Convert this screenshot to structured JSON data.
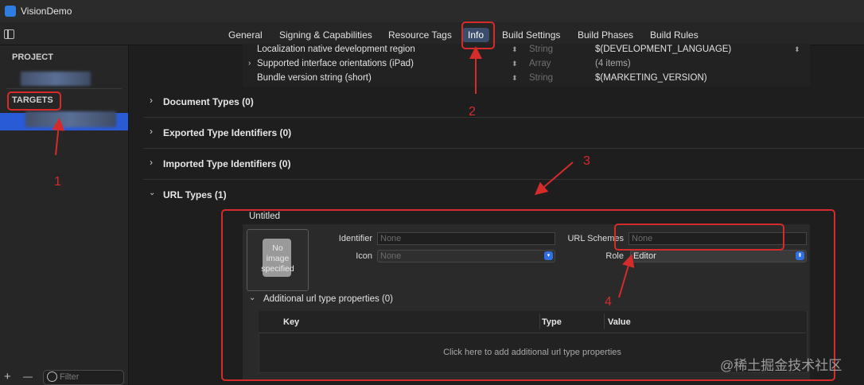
{
  "app": {
    "title": "VisionDemo"
  },
  "tabs": [
    {
      "label": "General"
    },
    {
      "label": "Signing & Capabilities"
    },
    {
      "label": "Resource Tags"
    },
    {
      "label": "Info"
    },
    {
      "label": "Build Settings"
    },
    {
      "label": "Build Phases"
    },
    {
      "label": "Build Rules"
    }
  ],
  "sidebar": {
    "project_header": "PROJECT",
    "targets_header": "TARGETS",
    "add": "+",
    "remove": "—",
    "filter_placeholder": "Filter"
  },
  "properties": [
    {
      "key": "Localization native development region",
      "type": "String",
      "value": "$(DEVELOPMENT_LANGUAGE)"
    },
    {
      "key": "Supported interface orientations (iPad)",
      "type": "Array",
      "value": "(4 items)"
    },
    {
      "key": "Bundle version string (short)",
      "type": "String",
      "value": "$(MARKETING_VERSION)"
    }
  ],
  "sections": [
    {
      "title": "Document Types (0)"
    },
    {
      "title": "Exported Type Identifiers (0)"
    },
    {
      "title": "Imported Type Identifiers (0)"
    },
    {
      "title": "URL Types (1)"
    }
  ],
  "url_type": {
    "name": "Untitled",
    "image_placeholder_line1": "No",
    "image_placeholder_line2": "image",
    "image_placeholder_line3": "specified",
    "identifier_label": "Identifier",
    "identifier_value": "None",
    "icon_label": "Icon",
    "icon_value": "None",
    "url_schemes_label": "URL Schemes",
    "url_schemes_value": "None",
    "role_label": "Role",
    "role_value": "Editor",
    "additional_label": "Additional url type properties (0)",
    "columns": [
      "Key",
      "Type",
      "Value"
    ],
    "empty_text": "Click here to add additional url type properties"
  },
  "annotations": [
    "1",
    "2",
    "3",
    "4"
  ],
  "watermark": "@稀土掘金技术社区",
  "colors": {
    "accent": "#2a5bd7",
    "annotation": "#d62b2b",
    "tab_selected": "#3a4e6b"
  }
}
